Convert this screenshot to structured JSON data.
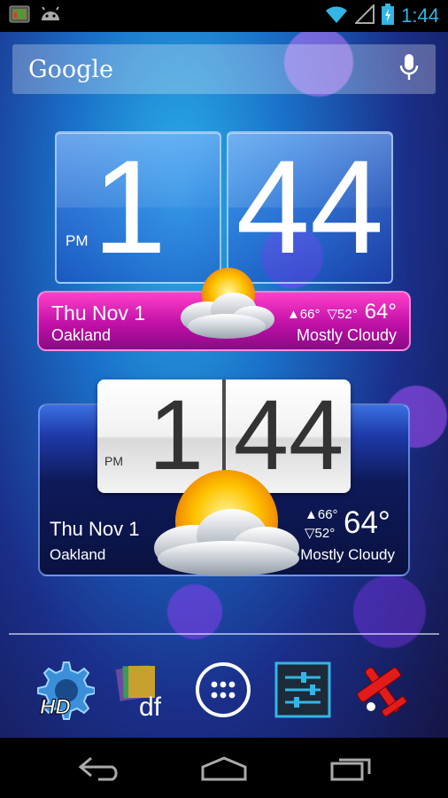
{
  "status_bar": {
    "time": "1:44",
    "icons": [
      "app-notification-icon",
      "android-icon",
      "wifi-icon",
      "signal-icon",
      "battery-charging-icon"
    ]
  },
  "search": {
    "logo": "Google",
    "mic_icon": "mic-icon"
  },
  "widget_flip_glass": {
    "hour": "1",
    "minute": "44",
    "ampm": "PM",
    "date": "Thu Nov 1",
    "city": "Oakland",
    "high": "▲66°",
    "low": "▽52°",
    "current": "64°",
    "condition": "Mostly Cloudy",
    "bar_color": "#e020b8"
  },
  "widget_flip_classic": {
    "hour": "1",
    "minute": "44",
    "ampm": "PM",
    "date": "Thu Nov 1",
    "city": "Oakland",
    "high": "▲66°",
    "low": "▽52°",
    "current": "64°",
    "condition": "Mostly Cloudy"
  },
  "dock": {
    "apps": [
      {
        "name": "hd-settings-app",
        "label": "HD"
      },
      {
        "name": "df-app",
        "label": "df"
      },
      {
        "name": "app-drawer",
        "label": ""
      },
      {
        "name": "settings-sliders-app",
        "label": ""
      },
      {
        "name": "airplane-app",
        "label": ""
      }
    ]
  },
  "nav": {
    "buttons": [
      "back-icon",
      "home-icon",
      "recent-apps-icon"
    ]
  }
}
